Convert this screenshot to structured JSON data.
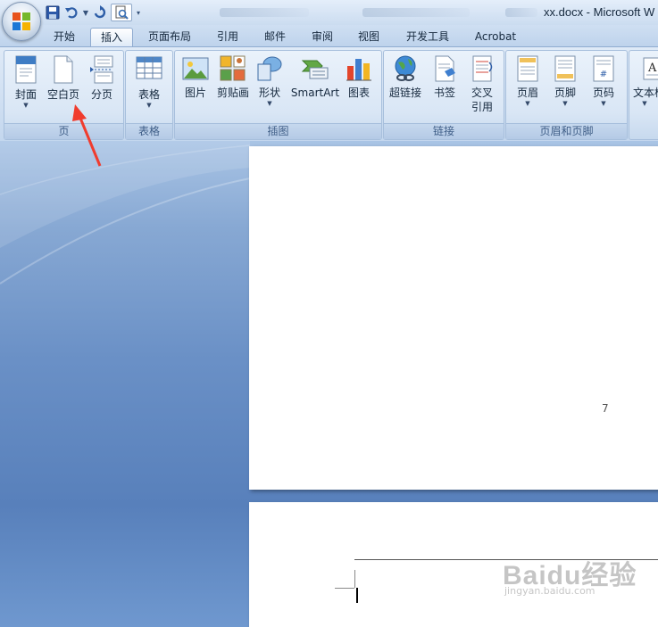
{
  "titlebar": {
    "document_title": "xx.docx - Microsoft W"
  },
  "tabs": [
    {
      "label": "开始"
    },
    {
      "label": "插入",
      "active": true
    },
    {
      "label": "页面布局"
    },
    {
      "label": "引用"
    },
    {
      "label": "邮件"
    },
    {
      "label": "审阅"
    },
    {
      "label": "视图"
    },
    {
      "label": "开发工具"
    },
    {
      "label": "Acrobat"
    }
  ],
  "ribbon": {
    "groups": {
      "pages": {
        "label": "页",
        "cover_page": "封面",
        "blank_page": "空白页",
        "page_break": "分页"
      },
      "tables": {
        "label": "表格",
        "table": "表格"
      },
      "illustrations": {
        "label": "插图",
        "picture": "图片",
        "clip_art": "剪贴画",
        "shapes": "形状",
        "smartart": "SmartArt",
        "chart": "图表"
      },
      "links": {
        "label": "链接",
        "hyperlink": "超链接",
        "bookmark": "书签",
        "cross_reference_1": "交叉",
        "cross_reference_2": "引用"
      },
      "header_footer": {
        "label": "页眉和页脚",
        "header": "页眉",
        "footer": "页脚",
        "page_number": "页码"
      },
      "text": {
        "text_box": "文本框"
      }
    }
  },
  "document": {
    "page_number": "7"
  },
  "watermark": {
    "main": "Baidu经验",
    "sub": "jingyan.baidu.com"
  },
  "colors": {
    "annotation_arrow": "#f03c2e",
    "ribbon_accent": "#8fabd0",
    "doc_background": "#5d83b8"
  }
}
